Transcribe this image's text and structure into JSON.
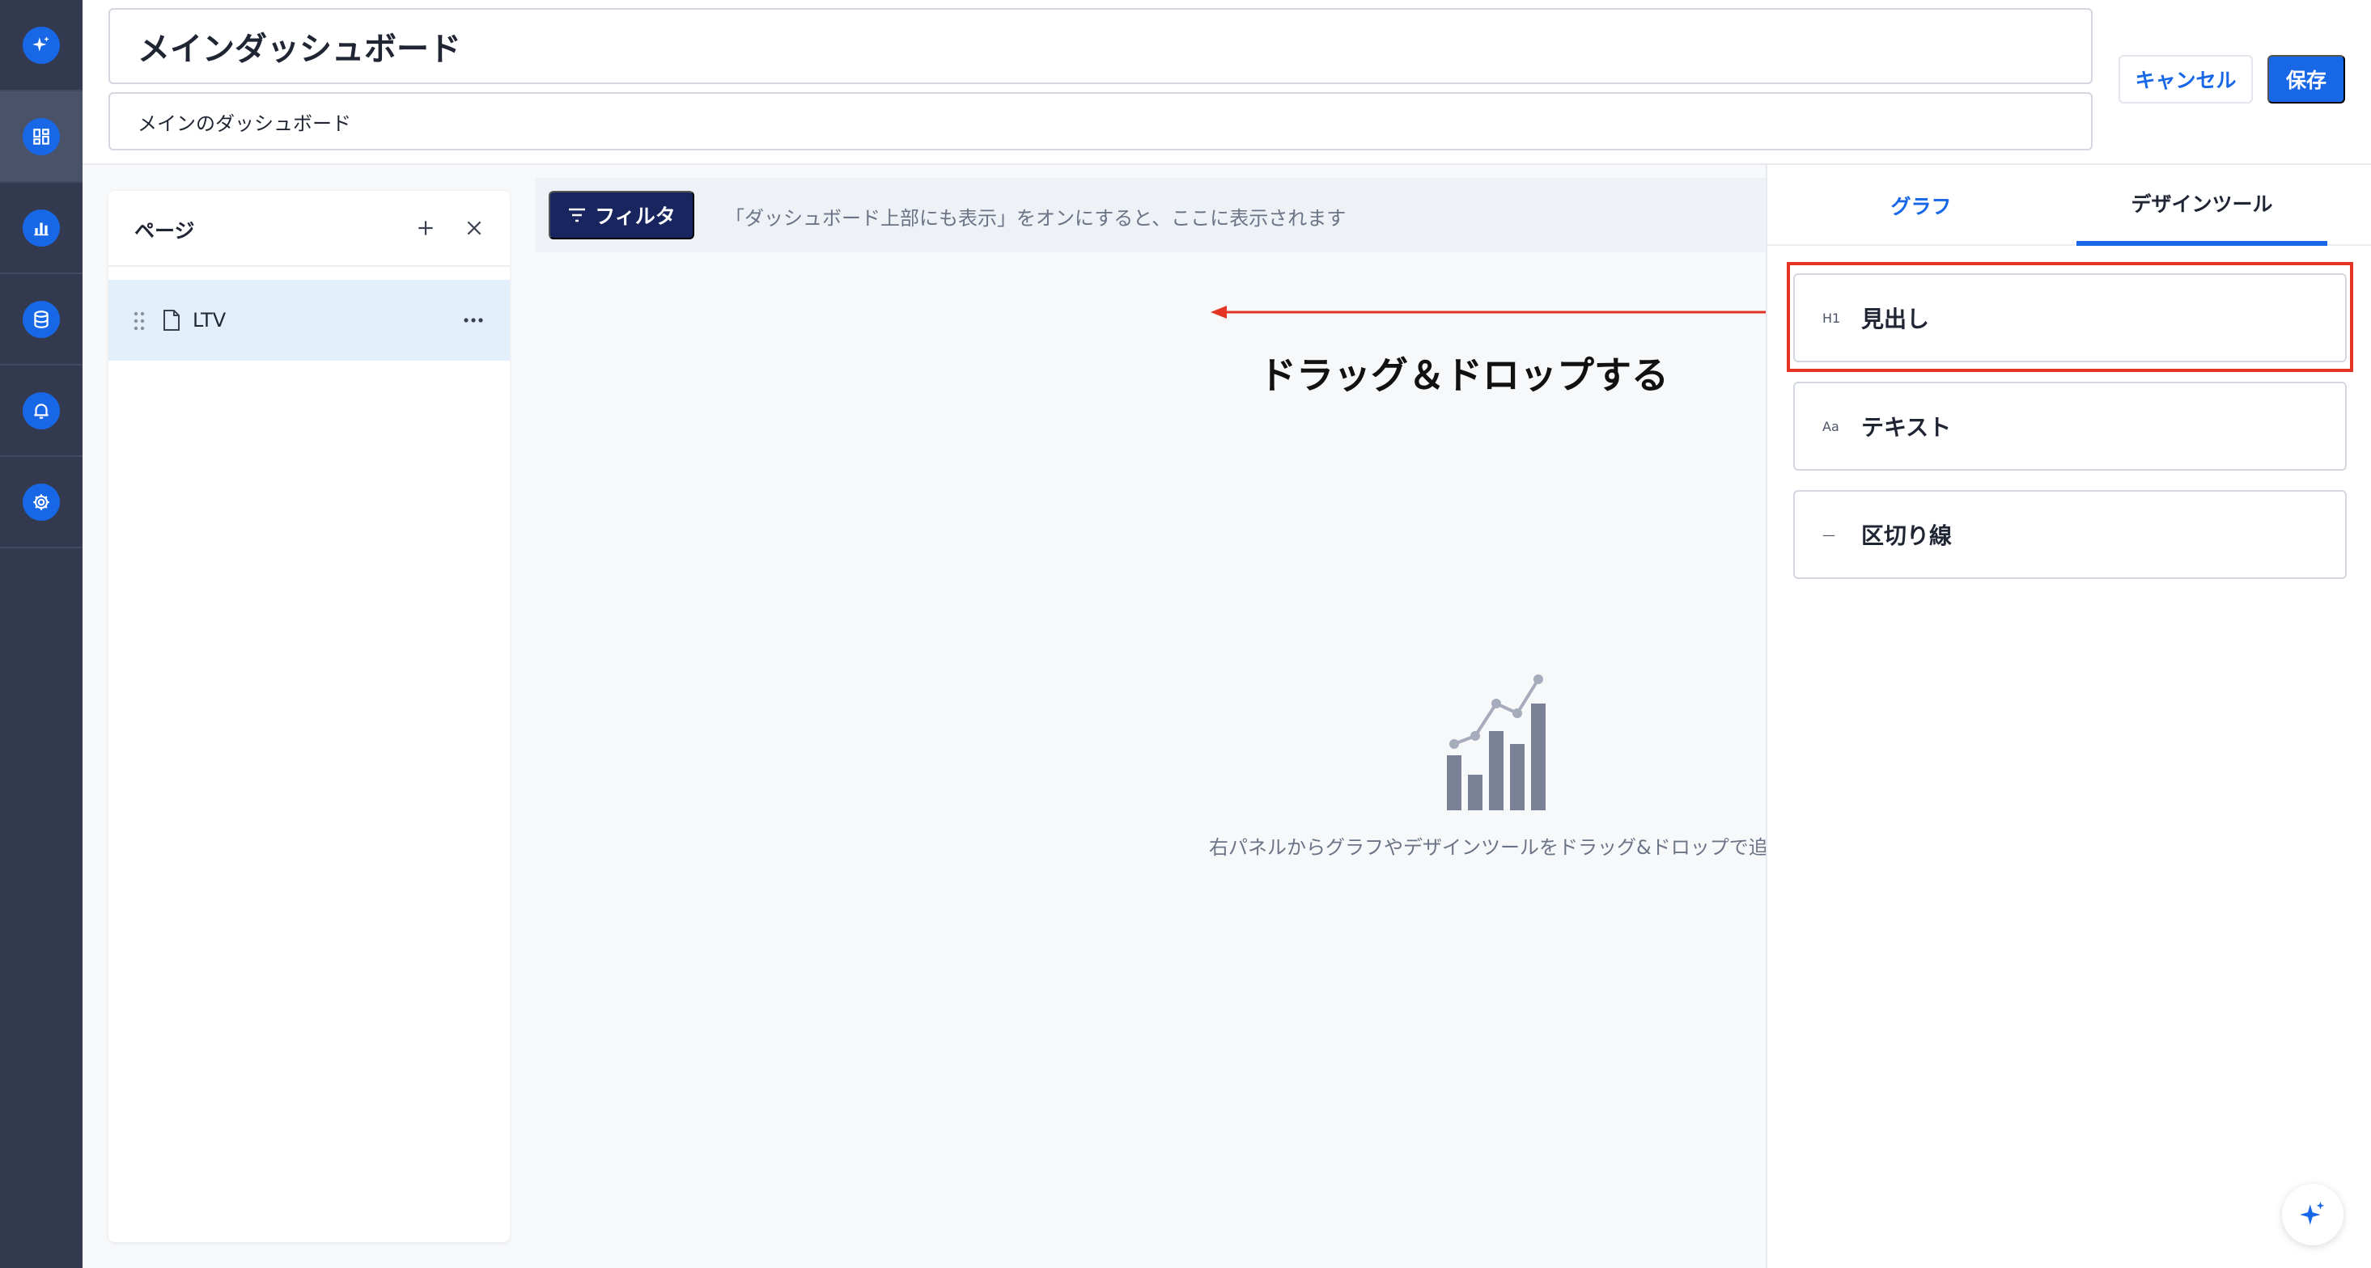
{
  "app": {
    "nav": [
      {
        "name": "ai-assistant",
        "icon": "sparkle-icon",
        "active": false
      },
      {
        "name": "dashboards",
        "icon": "dashboard-grid-icon",
        "active": true
      },
      {
        "name": "graphs",
        "icon": "bar-chart-icon",
        "active": false
      },
      {
        "name": "data-sources",
        "icon": "database-icon",
        "active": false
      },
      {
        "name": "alerts",
        "icon": "bell-icon",
        "active": false
      },
      {
        "name": "settings",
        "icon": "gear-icon",
        "active": false
      }
    ],
    "accent_color": "#1867e6",
    "rail_color": "#333a4f",
    "highlight_color": "#e33424"
  },
  "header": {
    "title": "メインダッシュボード",
    "description": "メインのダッシュボード",
    "cancel_label": "キャンセル",
    "save_label": "保存"
  },
  "pages_panel": {
    "title": "ページ",
    "pages": [
      {
        "label": "LTV",
        "selected": true
      }
    ]
  },
  "filter_bar": {
    "filter_label": "フィルタ",
    "hint": "「ダッシュボード上部にも表示」をオンにすると、ここに表示されます"
  },
  "annotation": {
    "text": "ドラッグ＆ドロップする"
  },
  "canvas": {
    "empty_message": "右パネルからグラフやデザインツールをドラッグ&ドロップで追"
  },
  "right_panel": {
    "tabs": [
      {
        "label": "グラフ",
        "active": false
      },
      {
        "label": "デザインツール",
        "active": true
      }
    ],
    "tools": [
      {
        "icon": "H1",
        "label": "見出し",
        "highlighted": true
      },
      {
        "icon": "Aa",
        "label": "テキスト",
        "highlighted": false
      },
      {
        "icon": "—",
        "label": "区切り線",
        "highlighted": false
      }
    ]
  }
}
